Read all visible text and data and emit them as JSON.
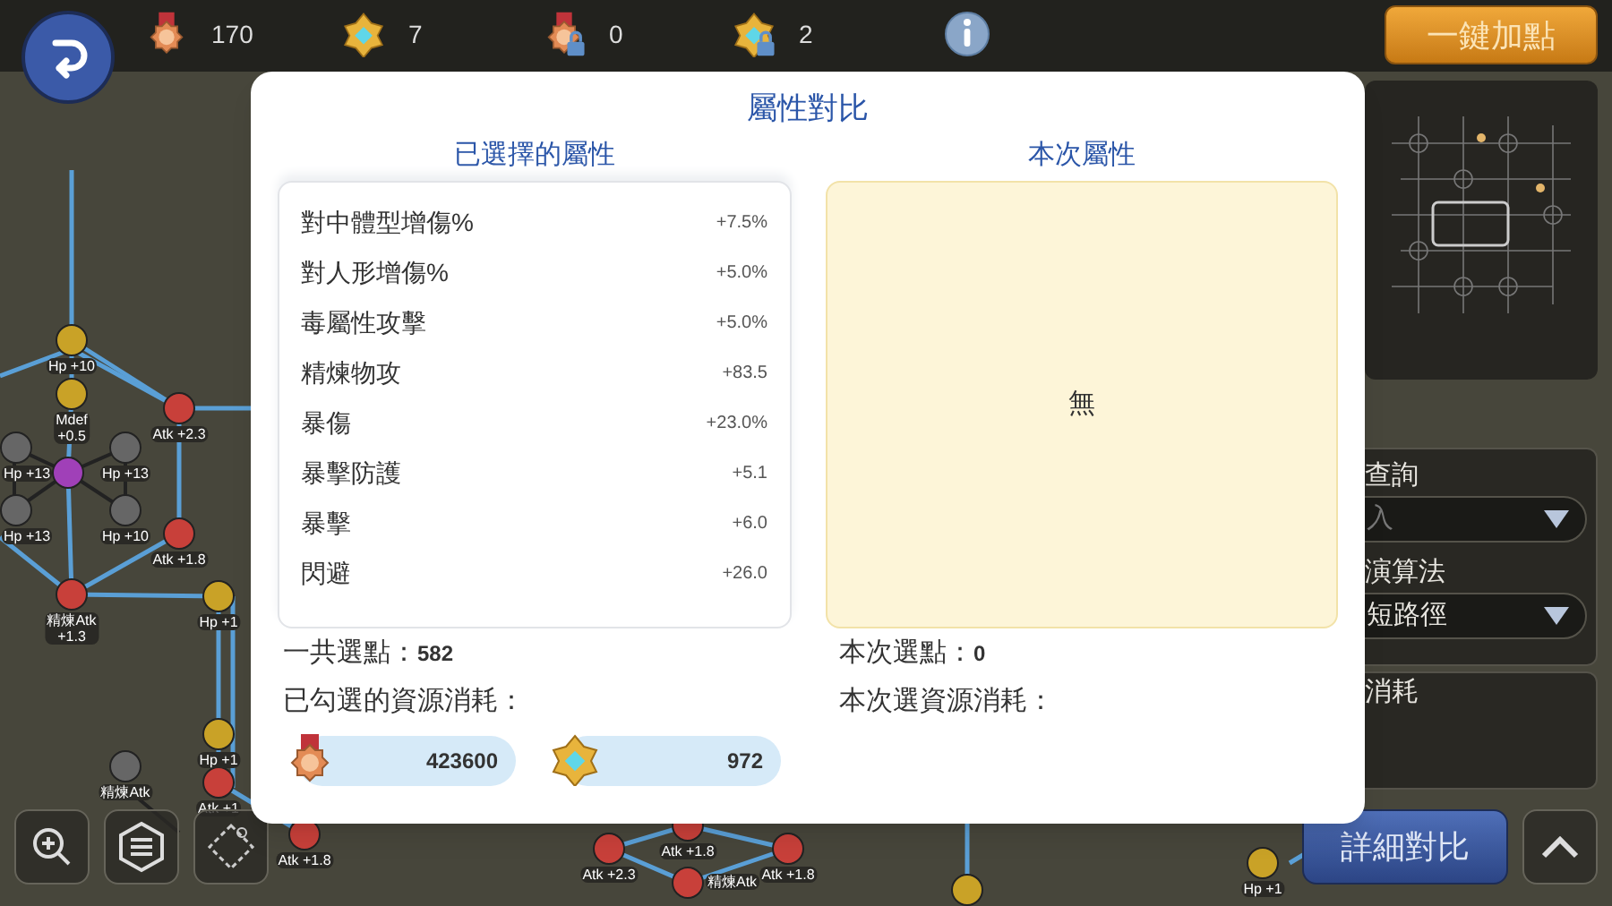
{
  "top_bar": {
    "resources": [
      {
        "kind": "medal",
        "locked": false,
        "count": "170"
      },
      {
        "kind": "cube",
        "locked": false,
        "count": "7"
      },
      {
        "kind": "medal",
        "locked": true,
        "count": "0"
      },
      {
        "kind": "cube",
        "locked": true,
        "count": "2"
      }
    ],
    "auto_button": "一鍵加點"
  },
  "skill_tree": {
    "nodes": [
      {
        "kind": "gold",
        "lines": [
          "Hp +10"
        ]
      },
      {
        "kind": "gold",
        "lines": [
          "Mdef",
          "+0.5"
        ]
      },
      {
        "kind": "red",
        "lines": [
          "Atk +2.3"
        ]
      },
      {
        "kind": "grey",
        "lines": [
          "Hp +13"
        ]
      },
      {
        "kind": "grey",
        "lines": [
          "Hp +13"
        ]
      },
      {
        "kind": "purple"
      },
      {
        "kind": "grey",
        "lines": [
          "Hp +13"
        ]
      },
      {
        "kind": "grey",
        "lines": [
          "Hp +10"
        ]
      },
      {
        "kind": "red",
        "lines": [
          "Atk +1.8"
        ]
      },
      {
        "kind": "red",
        "lines": [
          "精煉Atk",
          "+1.3"
        ]
      },
      {
        "kind": "gold",
        "lines": [
          "Hp +1"
        ]
      },
      {
        "kind": "gold",
        "lines": [
          "Hp +1"
        ]
      },
      {
        "kind": "grey",
        "lines": [
          "精煉Atk"
        ]
      },
      {
        "kind": "red",
        "lines": [
          "Atk +1"
        ]
      },
      {
        "kind": "red",
        "lines": [
          "Atk +1.8"
        ]
      },
      {
        "kind": "red",
        "lines": [
          "Atk +1.8"
        ]
      },
      {
        "kind": "red",
        "lines": [
          "Atk +2.3"
        ]
      },
      {
        "kind": "red",
        "lines": [
          "Atk +1.8"
        ]
      },
      {
        "kind": "red",
        "lines": [
          "精煉Atk"
        ]
      },
      {
        "kind": "gold"
      },
      {
        "kind": "gold",
        "lines": [
          "Hp +1"
        ]
      }
    ]
  },
  "side_panel": {
    "query_label": "查詢",
    "query_value": "入",
    "algorithm_label": "演算法",
    "algorithm_value": "短路徑",
    "cost_label": "消耗"
  },
  "compare_button": "詳細對比",
  "dialog": {
    "title": "屬性對比",
    "selected_header": "已選擇的屬性",
    "current_header": "本次屬性",
    "attributes": [
      {
        "name": "對中體型增傷%",
        "value": "+7.5%"
      },
      {
        "name": "對人形增傷%",
        "value": "+5.0%"
      },
      {
        "name": "毒屬性攻擊",
        "value": "+5.0%"
      },
      {
        "name": "精煉物攻",
        "value": "+83.5"
      },
      {
        "name": "暴傷",
        "value": "+23.0%"
      },
      {
        "name": "暴擊防護",
        "value": "+5.1"
      },
      {
        "name": "暴擊",
        "value": "+6.0"
      },
      {
        "name": "閃避",
        "value": "+26.0"
      }
    ],
    "current_empty": "無",
    "total_points_label": "一共選點：",
    "total_points_value": "582",
    "selected_cost_label": "已勾選的資源消耗：",
    "costs": [
      {
        "kind": "medal",
        "amount": "423600"
      },
      {
        "kind": "cube",
        "amount": "972"
      }
    ],
    "current_points_label": "本次選點：",
    "current_points_value": "0",
    "current_cost_label": "本次選資源消耗："
  }
}
